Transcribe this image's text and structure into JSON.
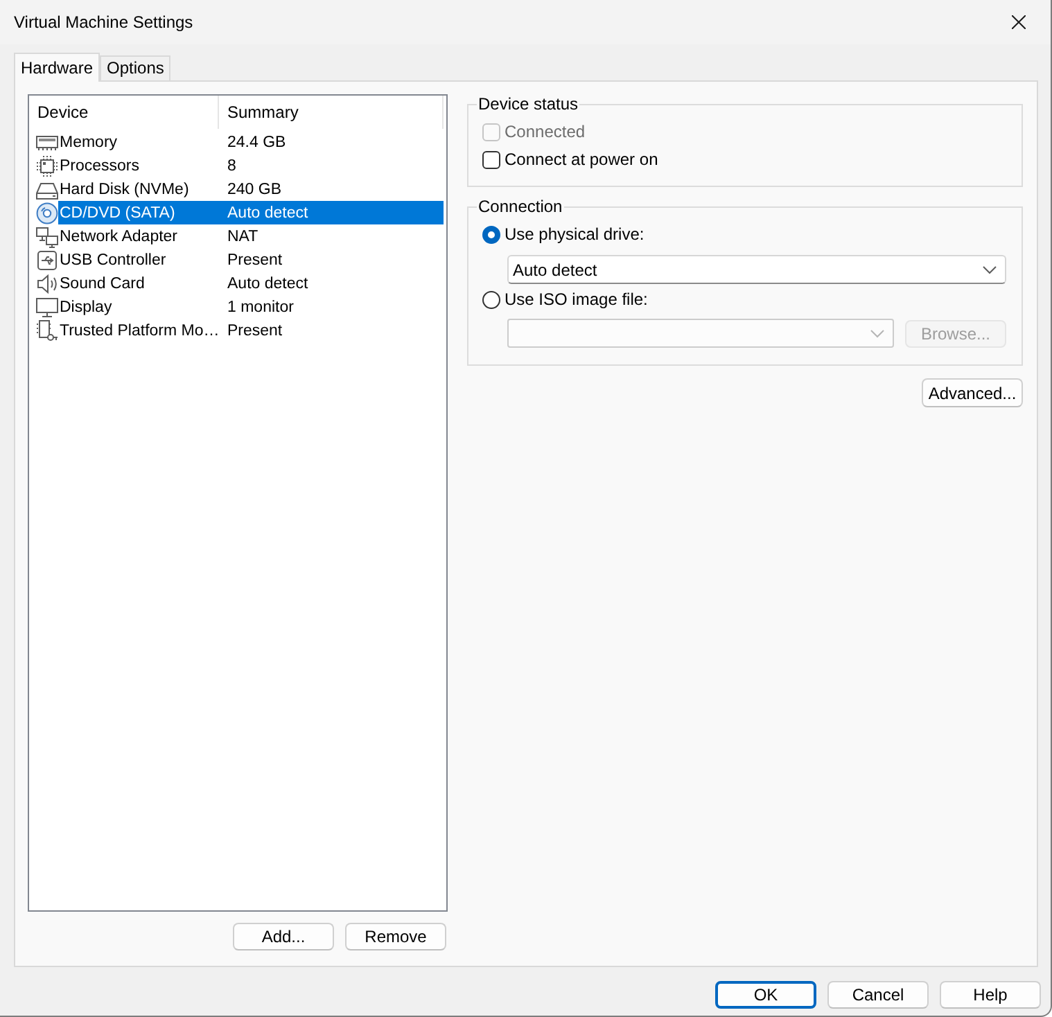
{
  "window": {
    "title": "Virtual Machine Settings"
  },
  "tabs": [
    {
      "label": "Hardware",
      "selected": true
    },
    {
      "label": "Options",
      "selected": false
    }
  ],
  "device_list": {
    "columns": [
      "Device",
      "Summary"
    ],
    "rows": [
      {
        "kind": "memory",
        "device": "Memory",
        "summary": "24.4 GB",
        "selected": false
      },
      {
        "kind": "processor",
        "device": "Processors",
        "summary": "8",
        "selected": false
      },
      {
        "kind": "disk",
        "device": "Hard Disk (NVMe)",
        "summary": "240 GB",
        "selected": false
      },
      {
        "kind": "optical",
        "device": "CD/DVD (SATA)",
        "summary": "Auto detect",
        "selected": true
      },
      {
        "kind": "network",
        "device": "Network Adapter",
        "summary": "NAT",
        "selected": false
      },
      {
        "kind": "usb",
        "device": "USB Controller",
        "summary": "Present",
        "selected": false
      },
      {
        "kind": "sound",
        "device": "Sound Card",
        "summary": "Auto detect",
        "selected": false
      },
      {
        "kind": "display",
        "device": "Display",
        "summary": "1 monitor",
        "selected": false
      },
      {
        "kind": "tpm",
        "device": "Trusted Platform Mo…",
        "summary": "Present",
        "selected": false
      }
    ]
  },
  "device_list_buttons": [
    "Add...",
    "Remove"
  ],
  "device_status": {
    "title": "Device status",
    "checkboxes": [
      {
        "label": "Connected",
        "checked": false,
        "disabled": true
      },
      {
        "label": "Connect at power on",
        "checked": false,
        "disabled": false
      }
    ]
  },
  "connection": {
    "title": "Connection",
    "options": [
      {
        "kind": "dropdown",
        "label": "Use physical drive:",
        "selected": true,
        "disabled": false,
        "value": "Auto detect"
      },
      {
        "kind": "file",
        "label": "Use ISO image file:",
        "selected": false,
        "disabled": true,
        "browse": "Browse..."
      }
    ]
  },
  "advanced_button": "Advanced...",
  "dialog_buttons": [
    {
      "label": "OK",
      "default": true
    },
    {
      "label": "Cancel",
      "default": false
    },
    {
      "label": "Help",
      "default": false
    }
  ]
}
